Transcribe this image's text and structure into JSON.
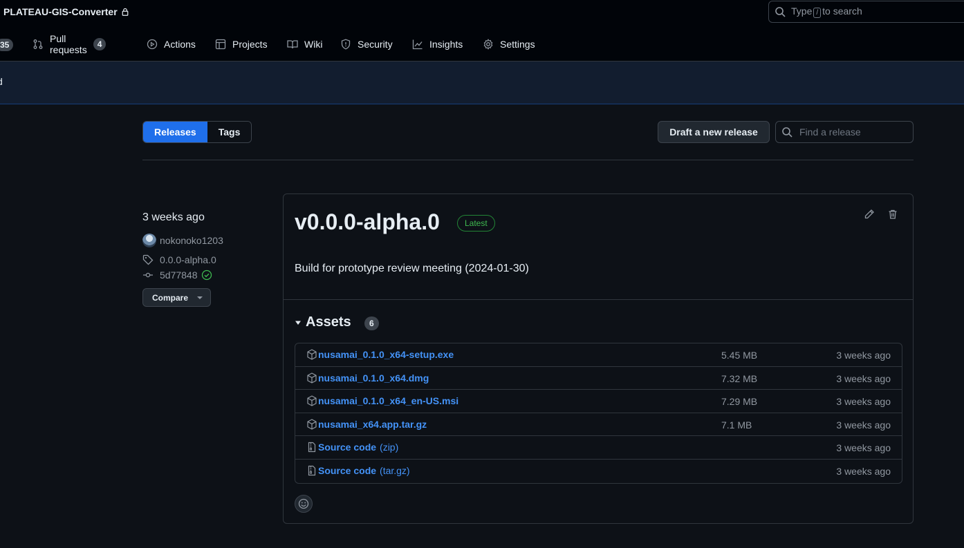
{
  "header": {
    "repo_name": "PLATEAU-GIS-Converter",
    "search_prefix": "Type",
    "search_key": "/",
    "search_suffix": "to search"
  },
  "nav": {
    "partial_counter": "35",
    "items": [
      {
        "label": "Pull requests",
        "icon": "pull-request-icon",
        "count": "4"
      },
      {
        "label": "Actions",
        "icon": "play-icon"
      },
      {
        "label": "Projects",
        "icon": "table-icon"
      },
      {
        "label": "Wiki",
        "icon": "book-icon"
      },
      {
        "label": "Security",
        "icon": "shield-icon"
      },
      {
        "label": "Insights",
        "icon": "graph-icon"
      },
      {
        "label": "Settings",
        "icon": "gear-icon"
      }
    ]
  },
  "banner": {
    "partial_text": "d"
  },
  "subnav": {
    "releases": "Releases",
    "tags": "Tags",
    "draft": "Draft a new release",
    "find_placeholder": "Find a release"
  },
  "release": {
    "time": "3 weeks ago",
    "author": "nokonoko1203",
    "tag": "0.0.0-alpha.0",
    "commit": "5d77848",
    "compare": "Compare",
    "title": "v0.0.0-alpha.0",
    "badge": "Latest",
    "body": "Build for prototype review meeting (2024-01-30)",
    "assets_label": "Assets",
    "assets_count": "6",
    "assets": [
      {
        "name": "nusamai_0.1.0_x64-setup.exe",
        "ext": "",
        "size": "5.45 MB",
        "date": "3 weeks ago",
        "icon": "package-icon"
      },
      {
        "name": "nusamai_0.1.0_x64.dmg",
        "ext": "",
        "size": "7.32 MB",
        "date": "3 weeks ago",
        "icon": "package-icon"
      },
      {
        "name": "nusamai_0.1.0_x64_en-US.msi",
        "ext": "",
        "size": "7.29 MB",
        "date": "3 weeks ago",
        "icon": "package-icon"
      },
      {
        "name": "nusamai_x64.app.tar.gz",
        "ext": "",
        "size": "7.1 MB",
        "date": "3 weeks ago",
        "icon": "package-icon"
      },
      {
        "name": "Source code",
        "ext": "(zip)",
        "size": "",
        "date": "3 weeks ago",
        "icon": "file-zip-icon"
      },
      {
        "name": "Source code",
        "ext": "(tar.gz)",
        "size": "",
        "date": "3 weeks ago",
        "icon": "file-zip-icon"
      }
    ]
  },
  "colors": {
    "accent": "#1f6feb",
    "link": "#4493f8",
    "success": "#3fb950",
    "bg": "#0d1117"
  }
}
